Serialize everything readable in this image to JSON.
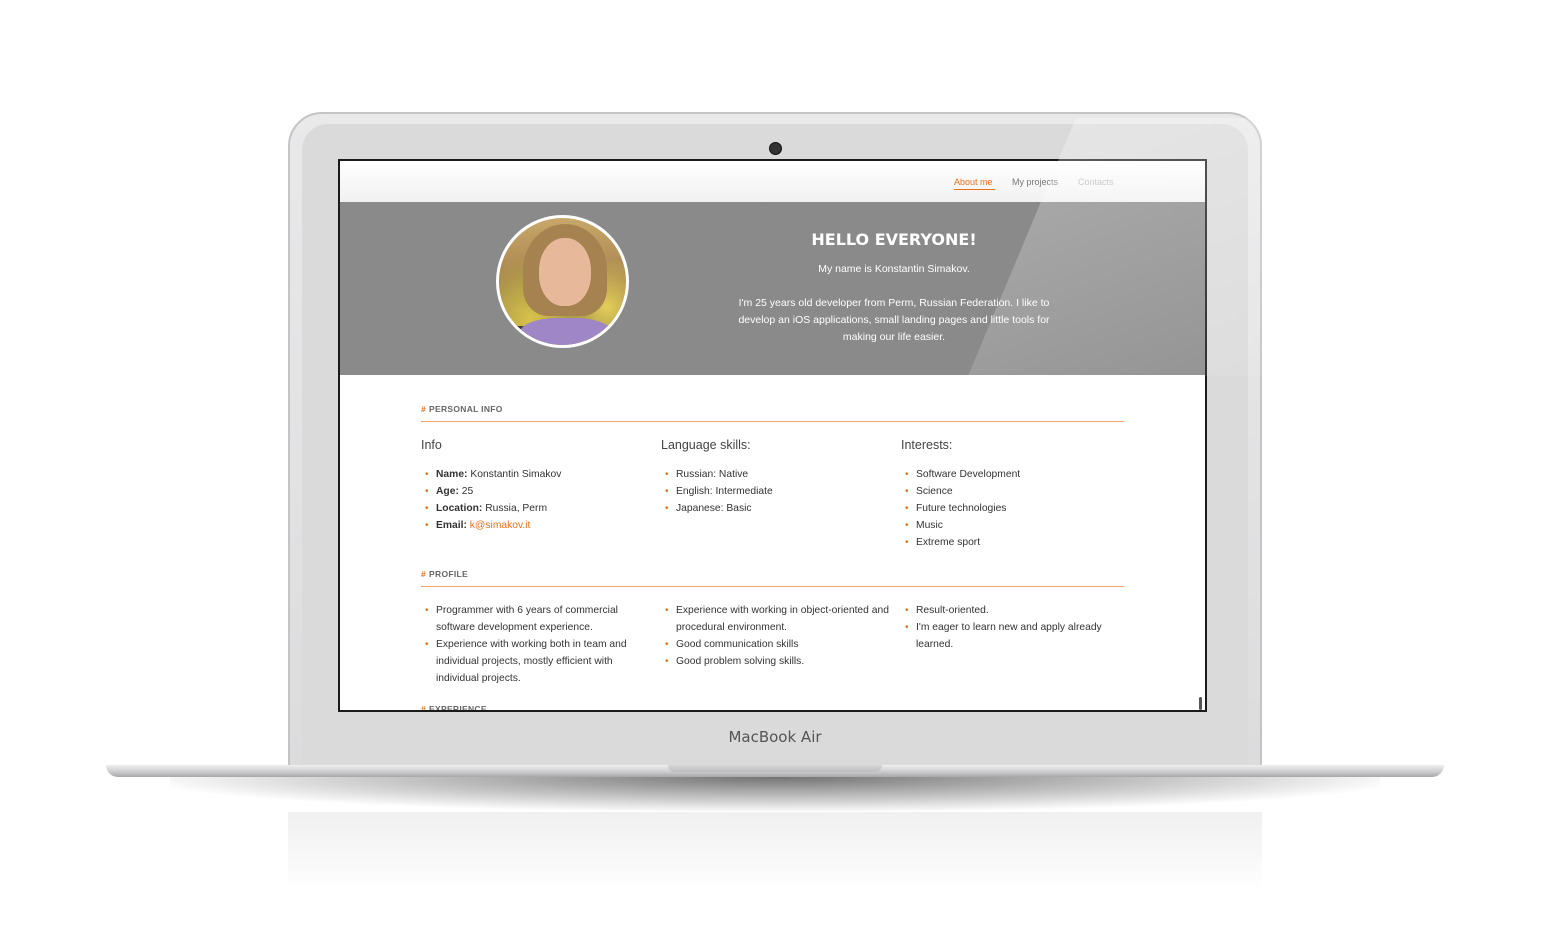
{
  "device": {
    "brand": "MacBook Air"
  },
  "nav": {
    "items": [
      {
        "label": "About me"
      },
      {
        "label": "My projects"
      },
      {
        "label": "Contacts"
      }
    ]
  },
  "hero": {
    "title": "HELLO EVERYONE!",
    "name_line": "My name is Konstantin Simakov.",
    "bio": "I'm 25 years old developer from Perm, Russian Federation. I like to develop an iOS applications, small landing pages and little tools for making our life easier."
  },
  "personal_info": {
    "heading": "PERSONAL INFO",
    "info": {
      "title": "Info",
      "items": [
        {
          "label": "Name:",
          "value": "Konstantin Simakov"
        },
        {
          "label": "Age:",
          "value": "25"
        },
        {
          "label": "Location:",
          "value": "Russia, Perm"
        },
        {
          "label": "Email:",
          "value": "k@simakov.it"
        }
      ]
    },
    "languages": {
      "title": "Language skills:",
      "items": [
        "Russian: Native",
        "English: Intermediate",
        "Japanese: Basic"
      ]
    },
    "interests": {
      "title": "Interests:",
      "items": [
        "Software Development",
        "Science",
        "Future technologies",
        "Music",
        "Extreme sport"
      ]
    }
  },
  "profile": {
    "heading": "PROFILE",
    "col1": [
      "Programmer with 6 years of commercial software development experience.",
      "Experience with working both in team and individual projects, mostly efficient with individual projects."
    ],
    "col2": [
      "Experience with working in object-oriented and procedural environment.",
      "Good communication skills",
      "Good problem solving skills."
    ],
    "col3": [
      "Result-oriented.",
      "I'm eager to learn new and apply already learned."
    ]
  },
  "experience": {
    "heading": "EXPERIENCE"
  },
  "colors": {
    "accent": "#e8721c",
    "hero_bg": "#8a8a8a"
  }
}
